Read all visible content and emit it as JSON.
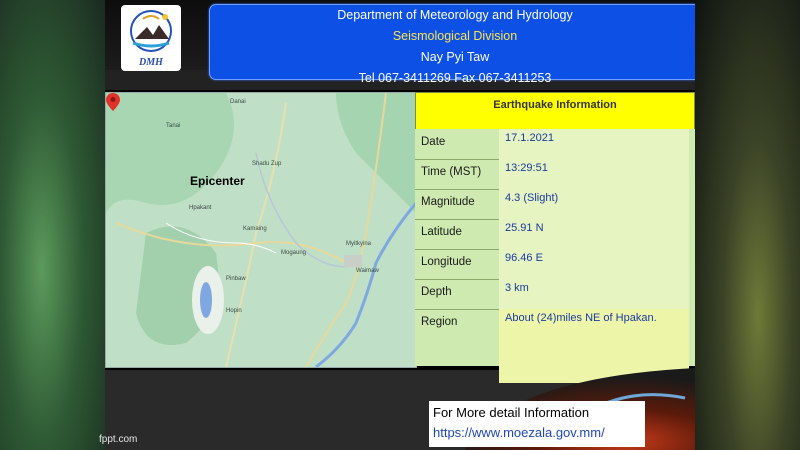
{
  "header": {
    "line1": "Department of Meteorology and Hydrology",
    "line2": "Seismological Division",
    "line3": "Nay Pyi Taw",
    "line4": "Tel 067-3411269 Fax 067-3411253"
  },
  "logo": {
    "text": "DMH"
  },
  "map": {
    "epicenter_label": "Epicenter",
    "places": [
      "Danai",
      "Shadu Zup",
      "Hpakant",
      "Kamaing",
      "Myitkyina",
      "Mogaung",
      "Pinbaw",
      "Hopin",
      "Waimaw",
      "Tanai"
    ]
  },
  "info": {
    "title": "Earthquake  Information",
    "rows": [
      {
        "label": "Date",
        "value": "17.1.2021"
      },
      {
        "label": "Time (MST)",
        "value": "13:29:51"
      },
      {
        "label": "Magnitude",
        "value": "4.3 (Slight)"
      },
      {
        "label": "Latitude",
        "value": "25.91  N"
      },
      {
        "label": "Longitude",
        "value": "96.46  E"
      },
      {
        "label": "Depth",
        "value": "3 km"
      },
      {
        "label": "Region",
        "value": "About  (24)miles  NE of  Hpakan."
      }
    ]
  },
  "detail": {
    "line1": "For More detail Information",
    "line2": "https://www.moezala.gov.mm/"
  },
  "credit": "fppt.com",
  "colors": {
    "header_bg": "#0c50e6",
    "header_highlight": "#ffe34a",
    "table_title_bg": "#ffff00",
    "value_text": "#1b3aa6",
    "link": "#1f47b8"
  }
}
